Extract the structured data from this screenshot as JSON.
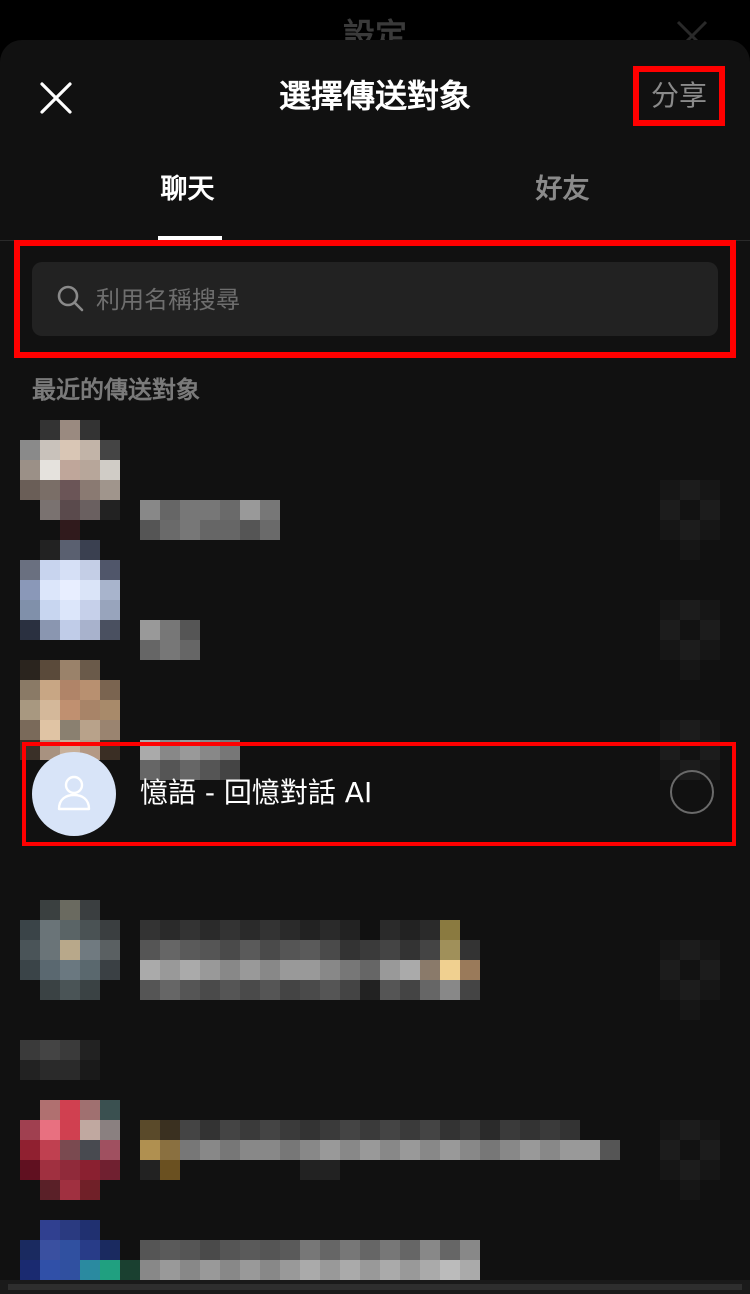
{
  "background_screen": {
    "title": "設定"
  },
  "header": {
    "title": "選擇傳送對象",
    "share_label": "分享"
  },
  "tabs": [
    {
      "label": "聊天",
      "active": true
    },
    {
      "label": "好友",
      "active": false
    }
  ],
  "search": {
    "placeholder": "利用名稱搜尋",
    "value": ""
  },
  "recent": {
    "section_label": "最近的傳送對象",
    "highlighted_contact": {
      "name": "憶語 - 回憶對話 AI",
      "selected": false
    }
  },
  "colors": {
    "sheet_bg": "#111111",
    "search_bg": "#222222",
    "highlight": "#ff0000",
    "ai_avatar_bg": "#d8e4f8",
    "secondary_text": "#8a8a8a"
  },
  "icons": {
    "close": "close-icon",
    "search": "search-icon",
    "avatar": "person-icon",
    "radio": "radio-circle-icon"
  }
}
